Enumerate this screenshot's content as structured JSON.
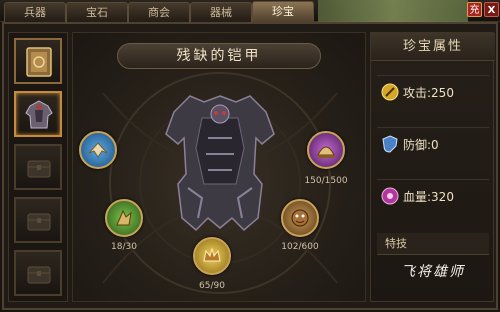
{
  "tabs": [
    {
      "label": "兵器",
      "active": false
    },
    {
      "label": "宝石",
      "active": false
    },
    {
      "label": "商会",
      "active": false
    },
    {
      "label": "器械",
      "active": false
    },
    {
      "label": "珍宝",
      "active": true
    }
  ],
  "top_buttons": {
    "flag_label": "充",
    "close_label": "X"
  },
  "main": {
    "item_title": "残缺的铠甲",
    "orbs": [
      {
        "name": "wing",
        "value": "",
        "color": "#3a89c9"
      },
      {
        "name": "claw",
        "value": "18/30",
        "color": "#4f8a2c"
      },
      {
        "name": "crown",
        "value": "65/90",
        "color": "#c9a32c"
      },
      {
        "name": "beast",
        "value": "102/600",
        "color": "#8a5a2c"
      },
      {
        "name": "dome",
        "value": "150/1500",
        "color": "#8a3a9a"
      }
    ]
  },
  "panel": {
    "title": "珍宝属性",
    "stats": [
      {
        "icon": "attack-icon",
        "text": "攻击:250"
      },
      {
        "icon": "defense-icon",
        "text": "防御:0"
      },
      {
        "icon": "hp-icon",
        "text": "血量:320"
      }
    ],
    "skill_label": "特技",
    "skill_name": "飞将雄师"
  }
}
